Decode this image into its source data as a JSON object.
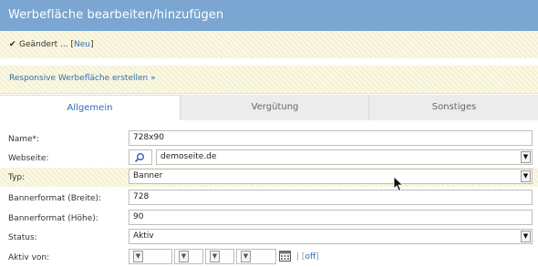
{
  "window": {
    "title": "Werbefläche bearbeiten/hinzufügen"
  },
  "notice": {
    "prefix": "Geändert ... [",
    "link": "Neu",
    "suffix": "]"
  },
  "responsive_link": "Responsive Werbefläche erstellen »",
  "tabs": [
    {
      "label": "Allgemein",
      "active": true
    },
    {
      "label": "Vergütung",
      "active": false
    },
    {
      "label": "Sonstiges",
      "active": false
    }
  ],
  "form": {
    "name": {
      "label": "Name*:",
      "value": "728x90"
    },
    "webseite": {
      "label": "Webseite:",
      "value": "demoseite.de"
    },
    "typ": {
      "label": "Typ:",
      "value": "Banner"
    },
    "breite": {
      "label": "Bannerformat (Breite):",
      "value": "728"
    },
    "hoehe": {
      "label": "Bannerformat (Höhe):",
      "value": "90"
    },
    "status": {
      "label": "Status:",
      "value": "Aktiv"
    },
    "aktiv_von": {
      "label": "Aktiv von:",
      "parts": [
        "-",
        "-",
        "-",
        "-"
      ],
      "separator": "|",
      "off_prefix": "[",
      "off_link": "off",
      "off_suffix": "]"
    }
  },
  "colors": {
    "titlebar": "#7aa6d1",
    "link": "#2f6db1",
    "notice_bg": "#fbf8e2",
    "tab_inactive": "#ececec"
  },
  "icons": [
    "checkmark-icon",
    "search-icon",
    "chevron-down-icon",
    "calendar-icon",
    "mouse-cursor-icon"
  ]
}
